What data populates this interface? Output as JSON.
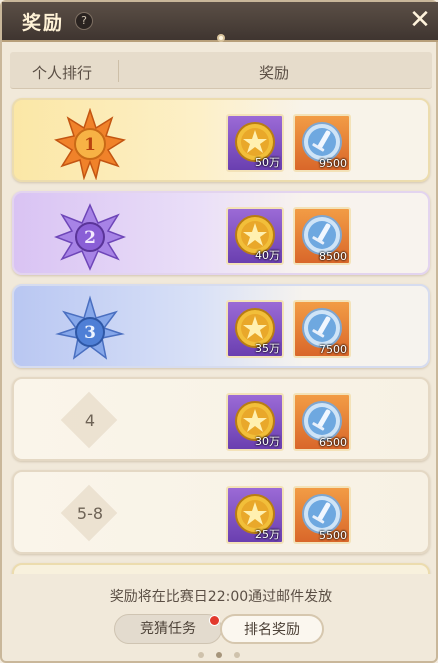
{
  "title": "奖励",
  "help_glyph": "?",
  "close_glyph": "✕",
  "headers": {
    "rank": "个人排行",
    "reward": "奖励"
  },
  "rows": [
    {
      "rank": "1",
      "style": "gold",
      "coin": "50万",
      "sword": "9500"
    },
    {
      "rank": "2",
      "style": "purple",
      "coin": "40万",
      "sword": "8500"
    },
    {
      "rank": "3",
      "style": "blue",
      "coin": "35万",
      "sword": "7500"
    },
    {
      "rank": "4",
      "style": "plain",
      "coin": "30万",
      "sword": "6500"
    },
    {
      "rank": "5-8",
      "style": "plain",
      "coin": "25万",
      "sword": "5500"
    }
  ],
  "footer_note": "奖励将在比赛日22:00通过邮件发放",
  "tabs": {
    "guess": "竞猜任务",
    "rank_reward": "排名奖励"
  },
  "colors": {
    "gold_medal": "#f0822a",
    "purple_medal": "#8a5fd6",
    "blue_medal": "#4f7fd6",
    "red_badge": "#e23a2e"
  },
  "icons": {
    "coin": "star-coin-icon",
    "sword": "sword-token-icon"
  }
}
